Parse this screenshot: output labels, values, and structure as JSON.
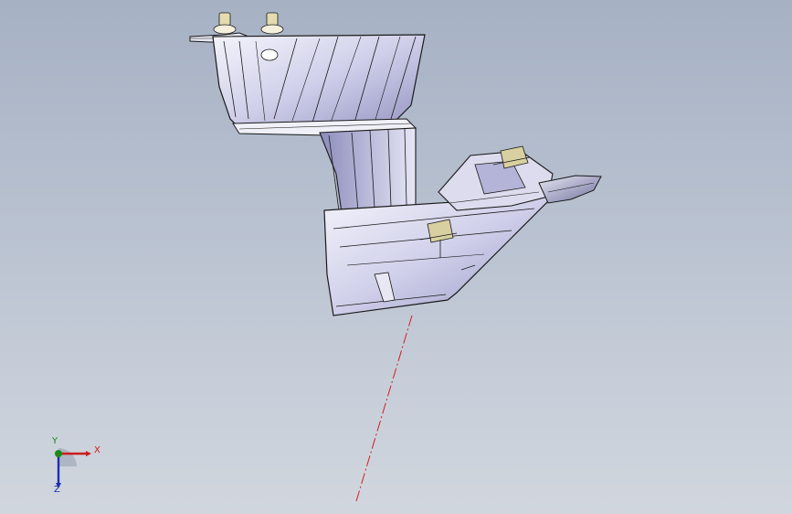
{
  "viewport": {
    "background_top": "#a6b1c4",
    "background_bottom": "#d1d6de"
  },
  "model": {
    "part_fill_light": "#f2f2fa",
    "part_fill_mid": "#c4c4e4",
    "part_fill_dark": "#7f7fae",
    "edge_color": "#1a1a1a",
    "clip_color": "#d8d0a0",
    "axis_line_color": "#d21f1f"
  },
  "triad": {
    "x_label": "X",
    "y_label": "Y",
    "z_label": "Z",
    "x_color": "#cc1c1c",
    "y_color": "#1a8a1a",
    "z_color": "#1b2fb0"
  }
}
